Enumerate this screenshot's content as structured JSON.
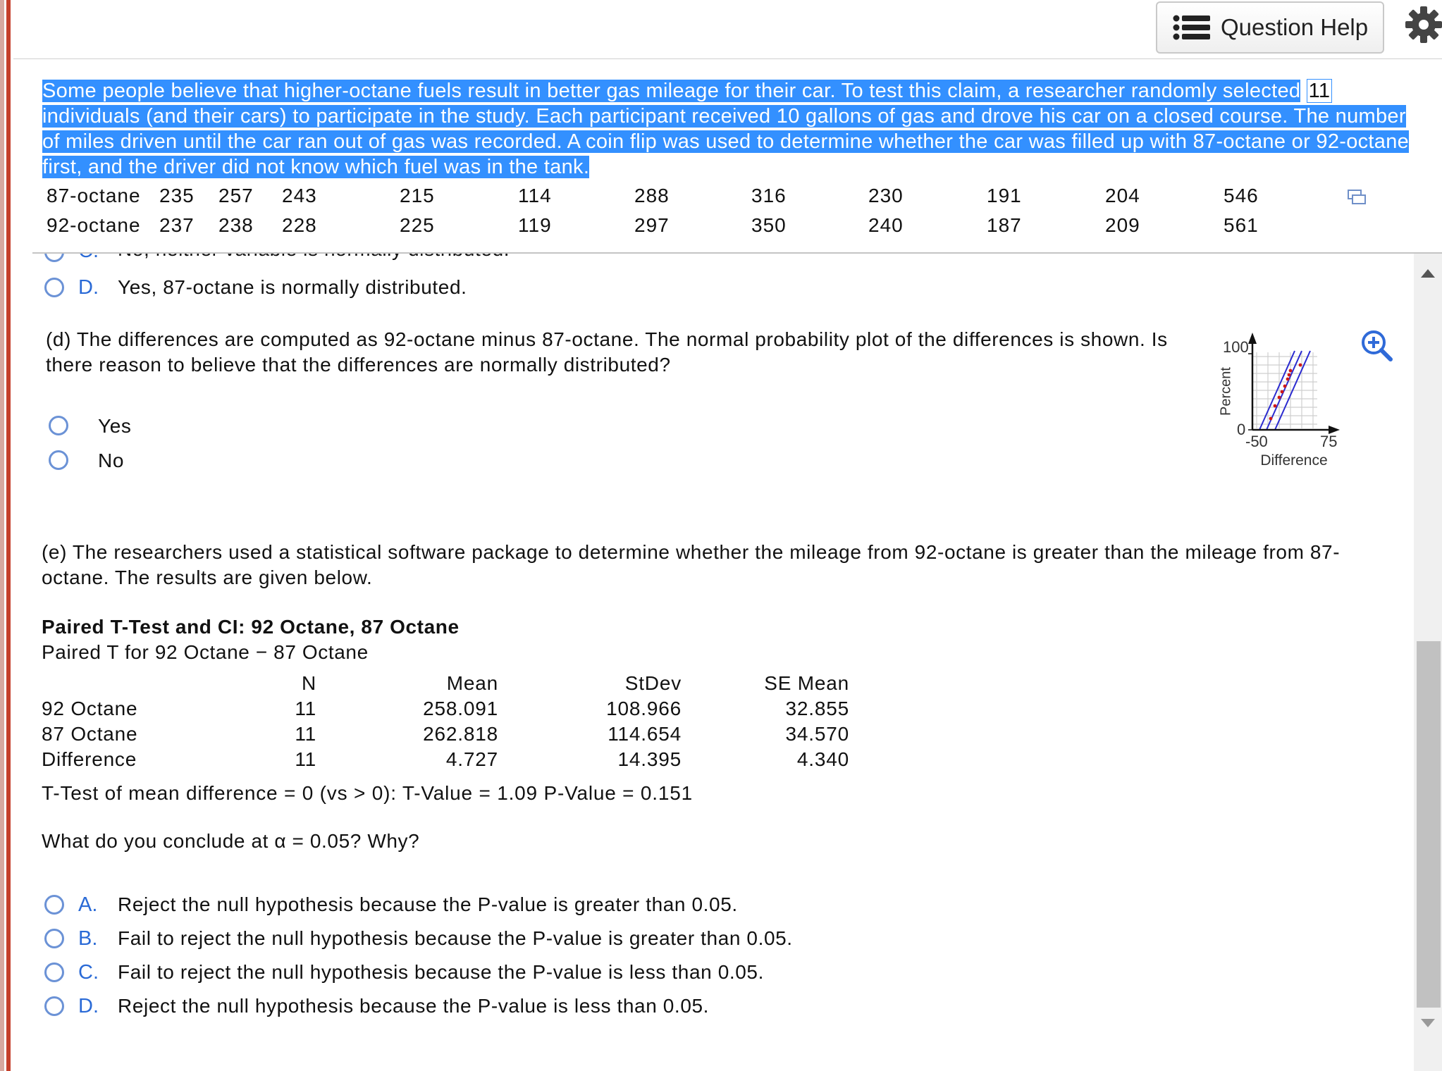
{
  "header": {
    "question_help_label": "Question Help"
  },
  "stem": {
    "text": "Some people believe that higher-octane fuels result in better gas mileage for their car. To test this claim, a researcher randomly selected",
    "count": "11",
    "text2": "individuals (and their cars) to participate in the study. Each participant received 10 gallons of gas and drove his car on a closed course. The number of miles driven until the car ran out of gas was recorded. A coin flip was used to determine whether the car was filled up with 87-octane or 92-octane first, and the driver did not know which fuel was in the tank."
  },
  "table": {
    "rows": [
      {
        "label": "87-octane",
        "values": [
          "235",
          "257",
          "243",
          "215",
          "114",
          "288",
          "316",
          "230",
          "191",
          "204",
          "546"
        ]
      },
      {
        "label": "92-octane",
        "values": [
          "237",
          "238",
          "228",
          "225",
          "119",
          "297",
          "350",
          "240",
          "187",
          "209",
          "561"
        ]
      }
    ]
  },
  "part_c": {
    "cut_letter": "C.",
    "cut_text": "No, neither variable is normally distributed.",
    "option_d_letter": "D.",
    "option_d_text": "Yes, 87-octane is normally distributed."
  },
  "part_d": {
    "question": "(d) The differences are computed as 92-octane minus 87-octane. The normal probability plot of the differences is shown. Is there reason to believe that the differences are normally distributed?",
    "options": [
      "Yes",
      "No"
    ],
    "plot": {
      "ylabel": "Percent",
      "xlabel": "Difference",
      "ytick_top": "100",
      "ytick_bottom": "0",
      "xtick_left": "-50",
      "xtick_right": "75"
    }
  },
  "part_e": {
    "intro": "(e) The researchers used a statistical software package to determine whether the mileage from 92-octane is greater than the mileage from 87-octane. The results are given below.",
    "output_title": "Paired T-Test and CI: 92 Octane, 87 Octane",
    "output_subtitle": "Paired T for 92 Octane − 87 Octane",
    "columns": [
      "N",
      "Mean",
      "StDev",
      "SE Mean"
    ],
    "rows": [
      {
        "label": "92 Octane",
        "cells": [
          "11",
          "258.091",
          "108.966",
          "32.855"
        ]
      },
      {
        "label": "87 Octane",
        "cells": [
          "11",
          "262.818",
          "114.654",
          "34.570"
        ]
      },
      {
        "label": "Difference",
        "cells": [
          "11",
          "4.727",
          "14.395",
          "4.340"
        ]
      }
    ],
    "test_line": "T-Test of mean difference  = 0 (vs  > 0): T-Value = 1.09 P-Value = 0.151",
    "question": "What do you conclude at α = 0.05? Why?",
    "options": [
      {
        "letter": "A.",
        "text": "Reject the null hypothesis because the P-value is greater than 0.05."
      },
      {
        "letter": "B.",
        "text": "Fail to reject the null hypothesis because the P-value is greater than 0.05."
      },
      {
        "letter": "C.",
        "text": "Fail to reject the null hypothesis because the P-value is less than 0.05."
      },
      {
        "letter": "D.",
        "text": "Reject the null hypothesis because the P-value is less than 0.05."
      }
    ]
  }
}
